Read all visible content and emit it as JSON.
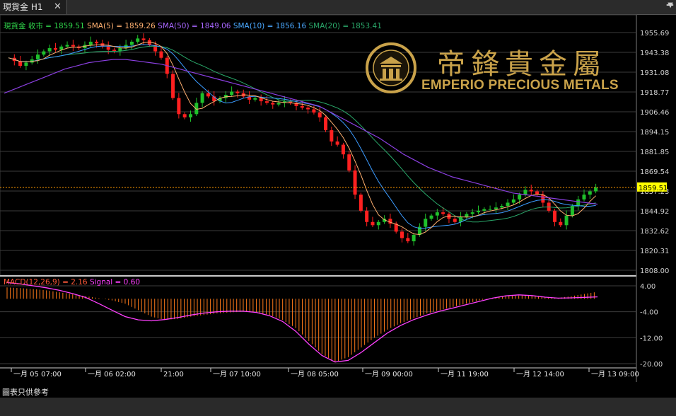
{
  "tab": {
    "title": "現貨金 H1",
    "close": "✕"
  },
  "legend": {
    "price": "現貨金 收市 = 1859.51",
    "sma5": "SMA(5) = 1859.26",
    "sma50": "SMA(50) = 1849.06",
    "sma10": "SMA(10) = 1856.16",
    "sma20": "SMA(20) = 1853.41"
  },
  "macd_legend": {
    "macd": "MACD(12,26,9) = 2.16",
    "signal": "Signal = 0.60"
  },
  "logo": {
    "chinese": "帝鋒貴金屬",
    "english": "EMPERIO PRECIOUS METALS"
  },
  "current_price": "1859.51",
  "footer": "圖表只供參考",
  "colors": {
    "up": "#1fc02b",
    "down": "#ff2020",
    "sma5": "#ffb070",
    "sma10": "#3b9bff",
    "sma20": "#2aa86a",
    "sma50": "#8a3fe0",
    "macd": "#ff7a1a",
    "signal": "#ff40ff",
    "gold": "#c9a24a",
    "price_line": "#ff9900"
  },
  "chart_data": {
    "type": "candlestick",
    "price_axis_ticks": [
      "1955.69",
      "1943.38",
      "1931.08",
      "1918.77",
      "1906.46",
      "1894.15",
      "1881.85",
      "1869.54",
      "1857.23",
      "1844.92",
      "1832.62",
      "1820.31",
      "1808.00"
    ],
    "ylim": [
      1808.0,
      1955.69
    ],
    "macd_ticks": [
      "4.00",
      "-4.00",
      "-12.00",
      "-20.00"
    ],
    "macd_ylim": [
      -20,
      4
    ],
    "time_labels": [
      "一月 05 07:00",
      "一月 06 02:00",
      "21:00",
      "一月 07 10:00",
      "一月 08 05:00",
      "一月 09 00:00",
      "一月 11 19:00",
      "一月 12 14:00",
      "一月 13 09:00"
    ],
    "close_series": [
      1940,
      1938,
      1935,
      1937,
      1939,
      1942,
      1944,
      1946,
      1945,
      1947,
      1948,
      1947,
      1946,
      1948,
      1950,
      1949,
      1947,
      1945,
      1944,
      1946,
      1948,
      1950,
      1952,
      1951,
      1948,
      1944,
      1940,
      1930,
      1915,
      1905,
      1903,
      1905,
      1912,
      1918,
      1916,
      1913,
      1915,
      1917,
      1919,
      1918,
      1916,
      1914,
      1915,
      1913,
      1912,
      1911,
      1912,
      1913,
      1912,
      1910,
      1909,
      1908,
      1906,
      1903,
      1895,
      1888,
      1886,
      1880,
      1870,
      1855,
      1845,
      1838,
      1836,
      1838,
      1840,
      1837,
      1832,
      1828,
      1826,
      1830,
      1835,
      1840,
      1842,
      1844,
      1843,
      1840,
      1838,
      1841,
      1843,
      1844,
      1845,
      1846,
      1846,
      1847,
      1848,
      1850,
      1852,
      1855,
      1858,
      1857,
      1855,
      1850,
      1845,
      1838,
      1836,
      1842,
      1848,
      1852,
      1855,
      1857,
      1859.51
    ],
    "sma50_series": [
      1918,
      1921,
      1924,
      1927,
      1930,
      1933,
      1935,
      1937,
      1938,
      1939,
      1939,
      1938,
      1937,
      1936,
      1934,
      1932,
      1930,
      1928,
      1926,
      1924,
      1922,
      1920,
      1918,
      1916,
      1914,
      1912,
      1910,
      1906,
      1902,
      1898,
      1894,
      1890,
      1885,
      1880,
      1876,
      1872,
      1869,
      1866,
      1864,
      1862,
      1860,
      1858,
      1856,
      1855,
      1854,
      1853,
      1852,
      1851,
      1850,
      1849.06
    ],
    "macd_series": [
      3.5,
      3.3,
      3.0,
      2.6,
      2.0,
      1.4,
      0.8,
      0.2,
      -0.5,
      -1.5,
      -3.5,
      -5.5,
      -6.5,
      -6.2,
      -5.5,
      -5.0,
      -4.5,
      -4.2,
      -4.0,
      -4.2,
      -5.0,
      -6.5,
      -9.0,
      -13.0,
      -17.0,
      -19.5,
      -18.0,
      -15.0,
      -12.0,
      -9.5,
      -7.5,
      -6.0,
      -4.5,
      -3.5,
      -2.5,
      -1.5,
      -0.5,
      0.3,
      0.8,
      1.0,
      1.0,
      0.6,
      0.3,
      0.8,
      1.5,
      2.16
    ],
    "signal_series": [
      5.0,
      4.6,
      4.0,
      3.4,
      2.6,
      1.6,
      0.4,
      -1.5,
      -3.5,
      -5.5,
      -6.5,
      -6.8,
      -6.4,
      -5.8,
      -5.0,
      -4.4,
      -4.0,
      -3.8,
      -3.8,
      -4.2,
      -5.2,
      -7.0,
      -10.0,
      -14.0,
      -17.5,
      -19.5,
      -19.0,
      -16.5,
      -13.5,
      -10.5,
      -8.2,
      -6.4,
      -5.0,
      -3.8,
      -2.8,
      -1.8,
      -0.8,
      0.2,
      0.9,
      1.2,
      1.0,
      0.5,
      0.2,
      0.3,
      0.45,
      0.6
    ]
  }
}
